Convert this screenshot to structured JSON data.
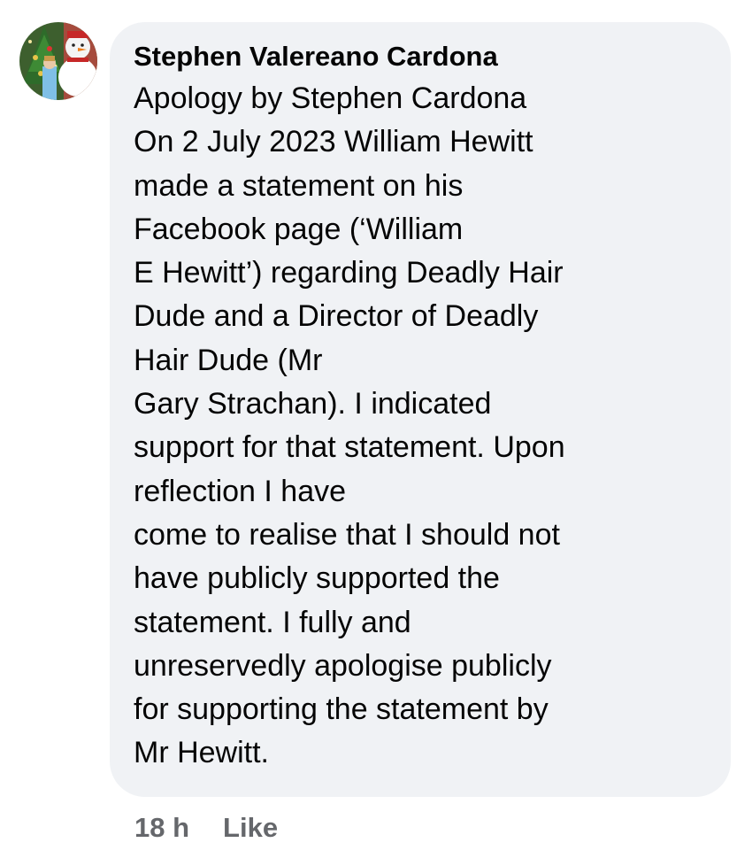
{
  "comment": {
    "author": "Stephen Valereano Cardona",
    "lines": [
      "Apology by Stephen Cardona",
      "On 2 July 2023 William Hewitt",
      "made a statement on his",
      "Facebook page (‘William",
      "E Hewitt’) regarding Deadly Hair",
      "Dude and a Director of Deadly",
      "Hair Dude (Mr",
      "Gary Strachan). I indicated",
      "support for that statement. Upon",
      "reflection I have",
      "come to realise that I should not",
      "have publicly supported the",
      "statement. I fully and",
      "unreservedly apologise publicly",
      "for supporting the statement by",
      "Mr Hewitt."
    ],
    "timestamp": "18 h",
    "like_label": "Like"
  },
  "colors": {
    "bubble_bg": "#f0f2f5",
    "text": "#050505",
    "meta": "#65676b"
  },
  "icons": {
    "avatar": "profile-photo-christmas-tree-snowman"
  }
}
